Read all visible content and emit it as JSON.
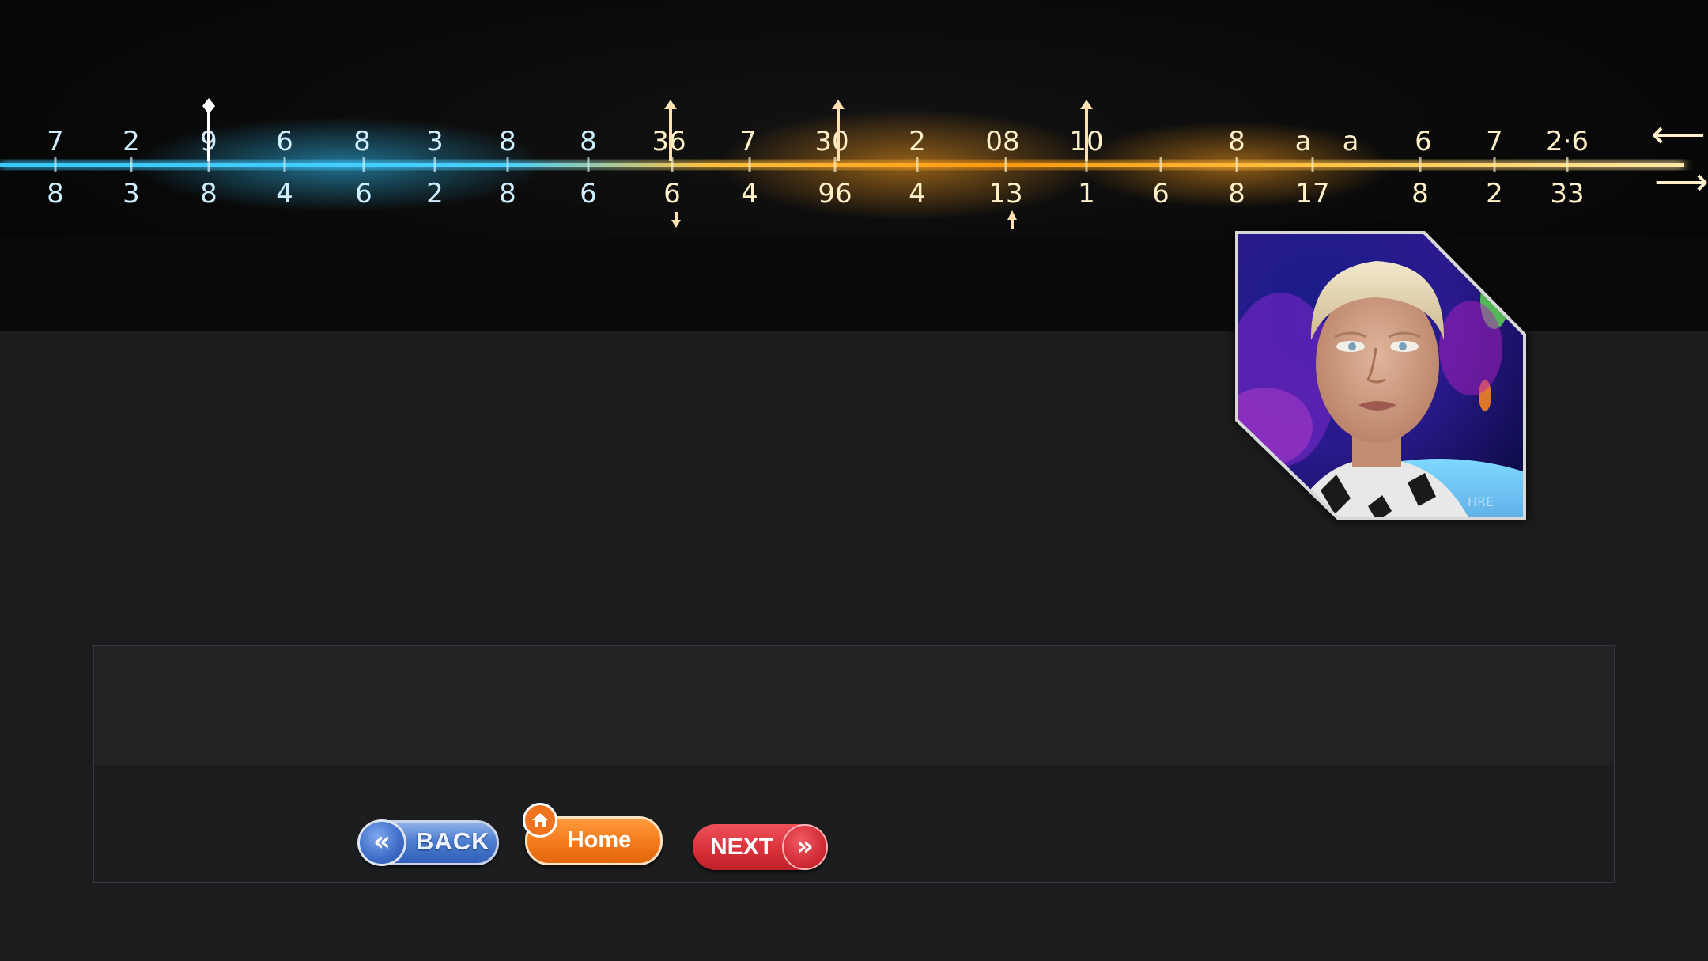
{
  "banner": {
    "top_digits": [
      "7",
      "2",
      "9",
      "6",
      "8",
      "3",
      "8",
      "8",
      "36",
      "7",
      "30",
      "2",
      "08",
      "10",
      "",
      "8",
      "a",
      "a",
      "6",
      "7",
      "2·6"
    ],
    "bottom_digits": [
      "8",
      "3",
      "8",
      "4",
      "6",
      "2",
      "8",
      "6",
      "6",
      "4",
      "96",
      "4",
      "13",
      "1",
      "6",
      "8",
      "17",
      "8",
      "2",
      "33"
    ],
    "arrow_glyph": "⟵",
    "arrow_glyph_lower": "⟶",
    "glow_colors": {
      "cool": "#34c6ff",
      "warm": "#ffb020",
      "hot": "#ff8a00"
    }
  },
  "portrait": {
    "icon": "person-portrait-image",
    "watermark": "HRE"
  },
  "buttons": {
    "back": {
      "label": "BACK",
      "icon": "double-chevron-left-icon",
      "glyph": "«",
      "color": "#4f7fd0"
    },
    "home": {
      "label": "Home",
      "icon": "home-icon",
      "color": "#f27a1c"
    },
    "next": {
      "label": "NEXT",
      "icon": "double-chevron-right-icon",
      "glyph": "»",
      "color": "#d62f38"
    }
  }
}
